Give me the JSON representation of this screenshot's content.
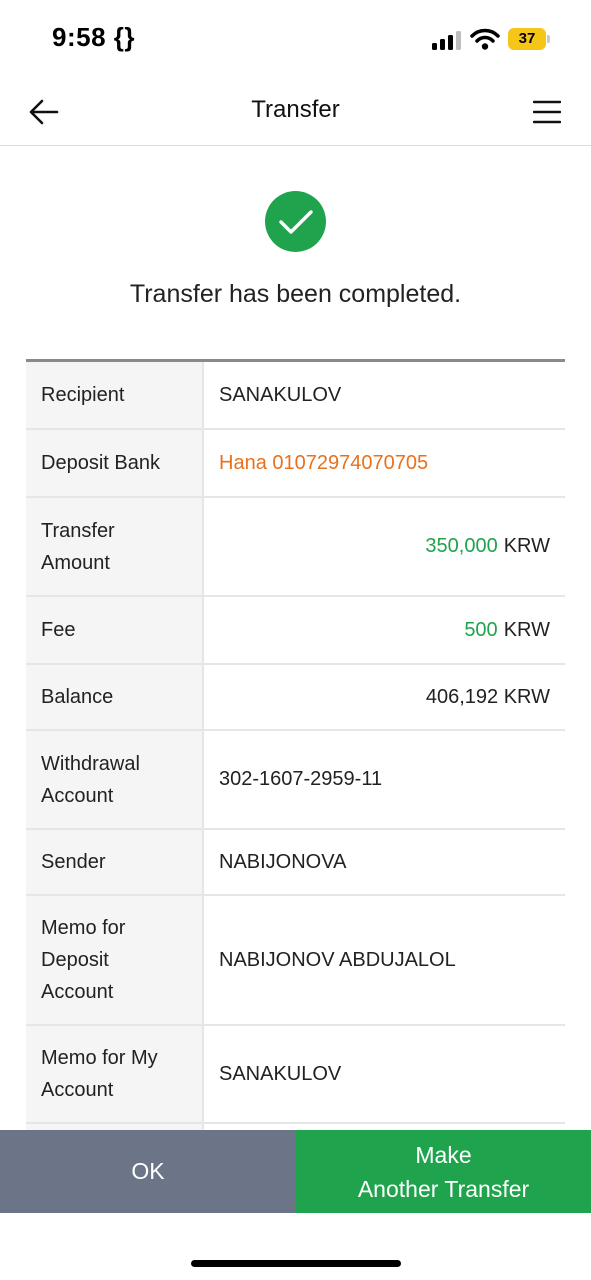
{
  "status_bar": {
    "time": "9:58 {}",
    "battery_level": "37",
    "icons": [
      "cellular-signal-icon",
      "wifi-icon",
      "battery-charging-icon"
    ],
    "battery_color": "#f5c518"
  },
  "header": {
    "title": "Transfer",
    "back_icon": "arrow-left-icon",
    "menu_icon": "hamburger-menu-icon"
  },
  "result": {
    "icon": "check-circle-icon",
    "message": "Transfer has been completed.",
    "icon_color": "#1fa44d"
  },
  "details": {
    "recipient": {
      "label": "Recipient",
      "value": "SANAKULOV"
    },
    "deposit_bank": {
      "label": "Deposit Bank",
      "value": "Hana 01072974070705"
    },
    "transfer_amount": {
      "label_line1": "Transfer",
      "label_line2": "Amount",
      "amount": "350,000",
      "currency": "KRW"
    },
    "fee": {
      "label": "Fee",
      "amount": "500",
      "currency": "KRW"
    },
    "balance": {
      "label": "Balance",
      "value": "406,192 KRW"
    },
    "withdrawal_account": {
      "label_line1": "Withdrawal",
      "label_line2": "Account",
      "value": "302-1607-2959-11"
    },
    "sender": {
      "label": "Sender",
      "value": "NABIJONOVA"
    },
    "memo_deposit": {
      "label_line1": "Memo for",
      "label_line2": "Deposit",
      "label_line3": "Account",
      "value": "NABIJONOV ABDUJALOL"
    },
    "memo_my": {
      "label_line1": "Memo for My",
      "label_line2": "Account",
      "value": "SANAKULOV"
    }
  },
  "actions": {
    "ok_label": "OK",
    "another_line1": "Make",
    "another_line2": "Another Transfer"
  },
  "colors": {
    "accent_green": "#1fa44d",
    "accent_orange": "#e8711c",
    "secondary_button": "#6c7587"
  }
}
